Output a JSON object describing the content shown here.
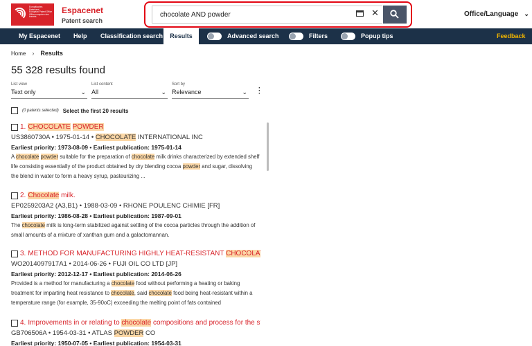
{
  "header": {
    "logo_text": [
      "Europäisches Patentamt",
      "European Patent Office",
      "Office européen des brevets"
    ],
    "brand_name": "Espacenet",
    "brand_sub": "Patent search",
    "search_value": "chocolate AND powder",
    "office_language": "Office/Language"
  },
  "nav": {
    "my_espacenet": "My Espacenet",
    "help": "Help",
    "classification_search": "Classification search",
    "results": "Results",
    "advanced_search": "Advanced search",
    "filters": "Filters",
    "popup_tips": "Popup tips",
    "feedback": "Feedback"
  },
  "breadcrumb": {
    "home": "Home",
    "current": "Results"
  },
  "results_count": "55 328 results found",
  "filters": {
    "list_view": {
      "label": "List view",
      "value": "Text only"
    },
    "list_content": {
      "label": "List content",
      "value": "All"
    },
    "sort_by": {
      "label": "Sort by",
      "value": "Relevance"
    }
  },
  "selection": {
    "selected_count": "(0 patents selected)",
    "select_label": "Select the first 20 results"
  },
  "colors": {
    "brand_red": "#d8232a",
    "nav_bg": "#1c3148",
    "highlight": "#fbd7a6",
    "feedback": "#f0b400"
  }
}
